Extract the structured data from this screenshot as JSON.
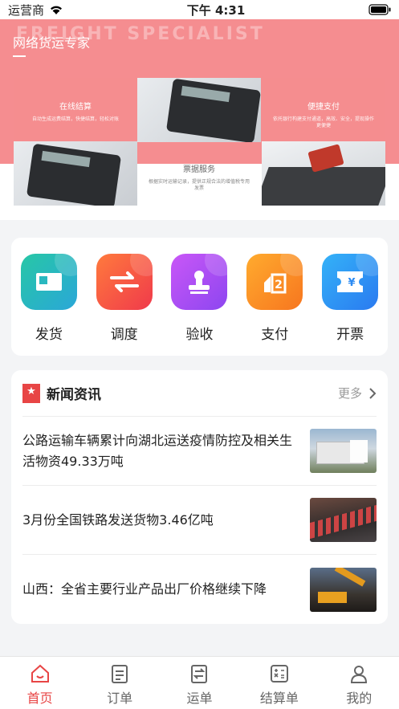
{
  "status": {
    "carrier": "运营商",
    "time": "下午 4:31"
  },
  "hero": {
    "watermark": "FREIGHT SPECIALIST",
    "title": "网络货运专家",
    "panels": [
      {
        "title": "在线结算",
        "desc": "自动生成运费结算，快捷结算，轻松对账"
      },
      {
        "title": "票据服务",
        "desc": "根据实时运输记录，提供正规合法的增值税专用发票"
      },
      {
        "title": "便捷支付",
        "desc": "依托银行构建支付通道，高效、安全，提现操作更便捷"
      }
    ]
  },
  "menu": [
    {
      "label": "发货",
      "icon": "ship-icon",
      "color": "#2ec0b2"
    },
    {
      "label": "调度",
      "icon": "dispatch-icon",
      "color": "#f4553f"
    },
    {
      "label": "验收",
      "icon": "stamp-icon",
      "color": "#b04bf2"
    },
    {
      "label": "支付",
      "icon": "pay-icon",
      "color": "#f8941d"
    },
    {
      "label": "开票",
      "icon": "invoice-icon",
      "color": "#2a9af5"
    }
  ],
  "news": {
    "title": "新闻资讯",
    "more": "更多",
    "items": [
      {
        "text": "公路运输车辆累计向湖北运送疫情防控及相关生活物资49.33万吨"
      },
      {
        "text": "3月份全国铁路发送货物3.46亿吨"
      },
      {
        "text": "山西：全省主要行业产品出厂价格继续下降"
      }
    ]
  },
  "tabs": [
    {
      "label": "首页",
      "active": true
    },
    {
      "label": "订单"
    },
    {
      "label": "运单"
    },
    {
      "label": "结算单"
    },
    {
      "label": "我的"
    }
  ]
}
